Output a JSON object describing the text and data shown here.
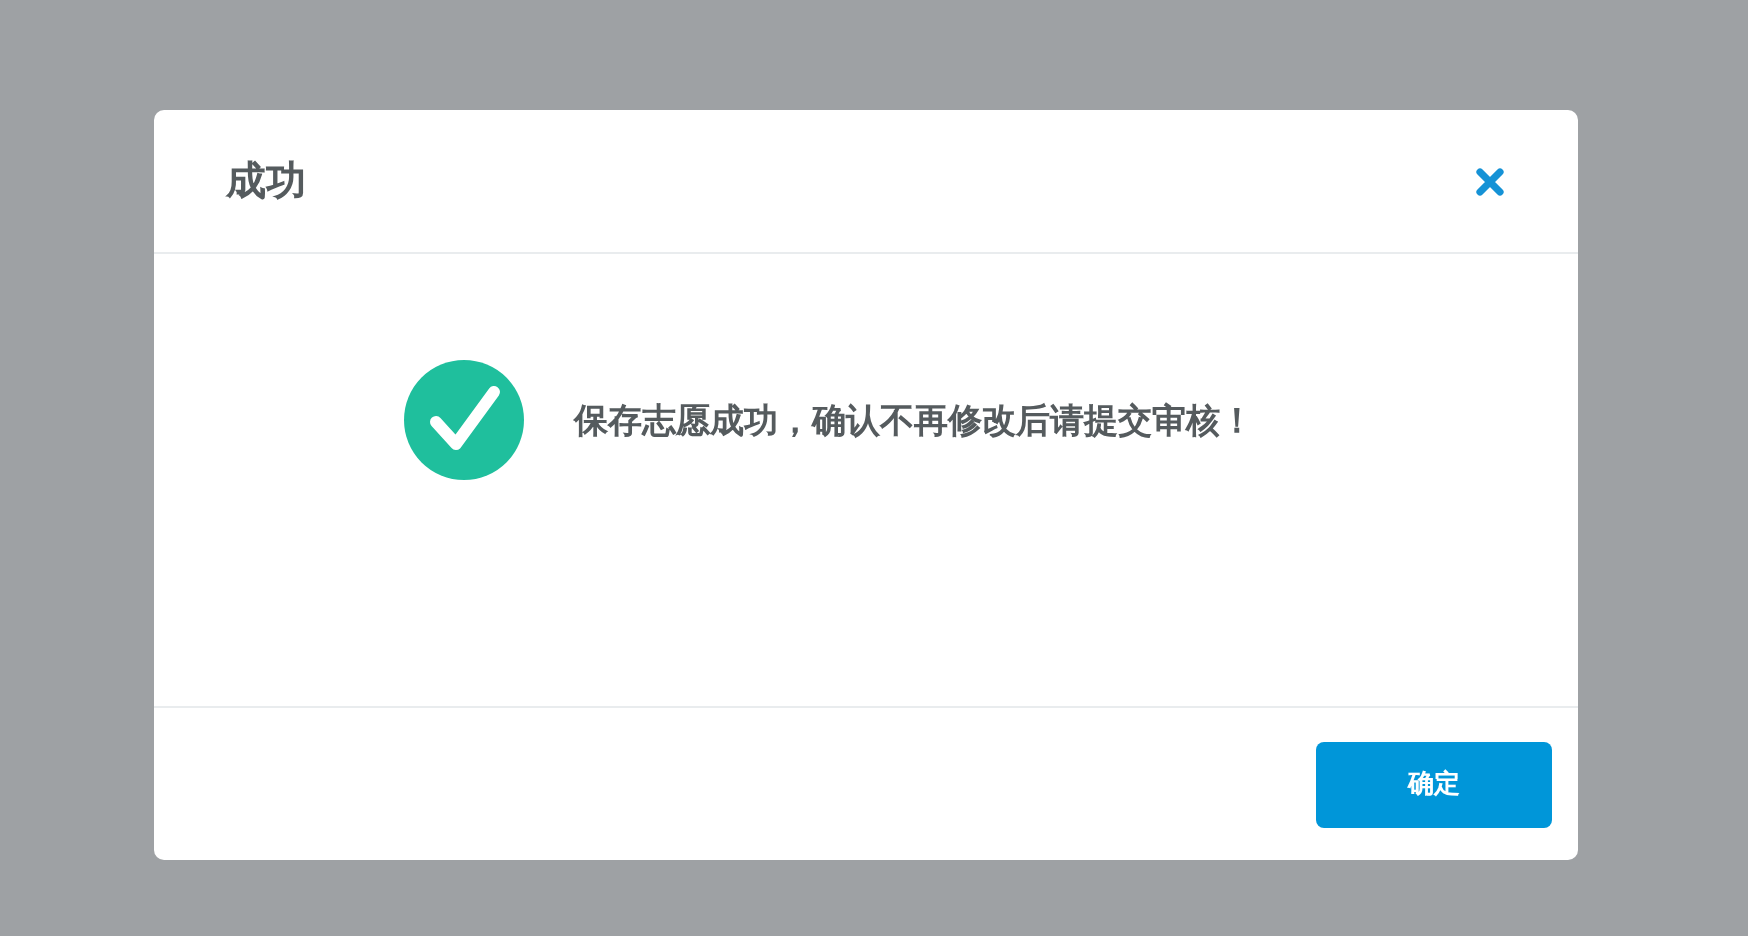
{
  "dialog": {
    "title": "成功",
    "message": "保存志愿成功，确认不再修改后请提交审核！",
    "buttons": [
      "确定"
    ]
  }
}
